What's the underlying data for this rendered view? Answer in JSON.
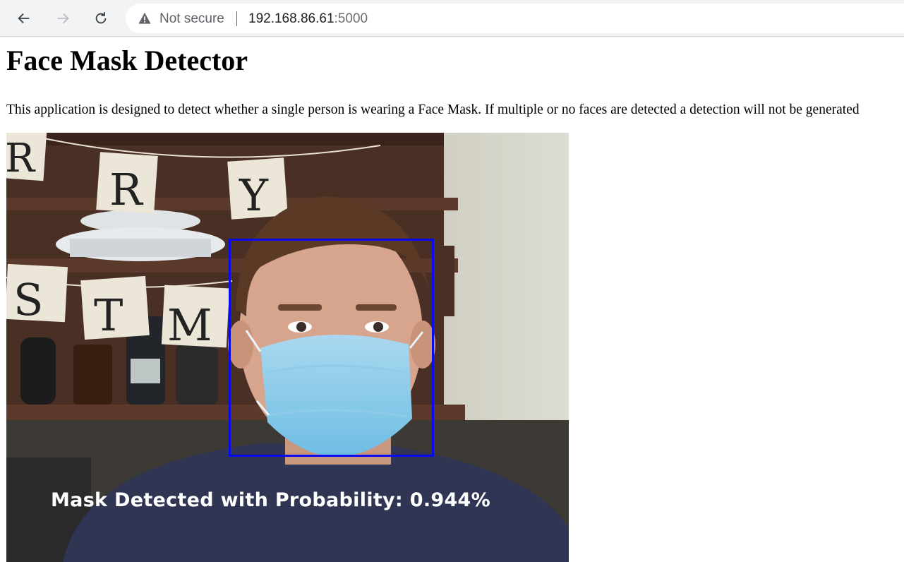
{
  "browser": {
    "security_status": "Not secure",
    "url_host": "192.168.86.61",
    "url_port": ":5000",
    "icons": {
      "back": "arrow-left-icon",
      "forward": "arrow-right-icon",
      "reload": "reload-icon",
      "security": "warning-triangle-icon"
    }
  },
  "page": {
    "title": "Face Mask Detector",
    "description": "This application is designed to detect whether a single person is wearing a Face Mask. If multiple or no faces are detected a detection will not be generated"
  },
  "video": {
    "banner_letters_top": [
      "R",
      "R",
      "Y"
    ],
    "banner_letters_middle": [
      "S",
      "T",
      "M"
    ],
    "detection": {
      "label": "Mask Detected with Probability: 0.944%",
      "box_color": "#0a0aee"
    }
  }
}
